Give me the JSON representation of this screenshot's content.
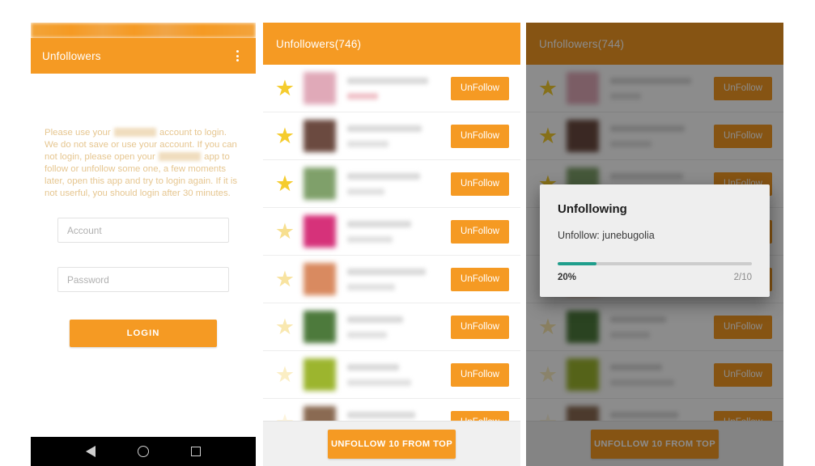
{
  "login_screen": {
    "appbar": {
      "title": "Unfollowers",
      "overflow_label": "⋮"
    },
    "note": {
      "part1": "Please use your",
      "redacted1": "Instagram",
      "part2": "account to login. We do not save or use your account. If you can not login, please open your",
      "redacted2": "Instagram",
      "part3": "app to follow or unfollow some one, a few moments later, open this app and try to login again. If it is not userful, you should login after 30 minutes."
    },
    "account_placeholder": "Account",
    "account_value": "",
    "password_placeholder": "Password",
    "password_value": "",
    "login_button": "LOGIN",
    "navbar": {
      "back": "back-triangle",
      "home": "home-circle",
      "recents": "recents-square"
    }
  },
  "list_screen": {
    "appbar_title": "Unfollowers(746)",
    "unfollow_label": "UnFollow",
    "bulk_button": "UNFOLLOW 10 FROM TOP",
    "star_glyph": "★",
    "rows": [
      {
        "star_color": "#f5cc2e",
        "avatar_color": "#e0a9b8",
        "name_w": "78%",
        "sub_w": "30%",
        "sub_color": "#f0c2c8"
      },
      {
        "star_color": "#f5cc2e",
        "avatar_color": "#6b4a40",
        "name_w": "72%",
        "sub_w": "40%",
        "sub_color": "#e0e0e0"
      },
      {
        "star_color": "#f5cc2e",
        "avatar_color": "#7fa06a",
        "name_w": "70%",
        "sub_w": "36%",
        "sub_color": "#e0e0e0"
      },
      {
        "star_color": "#f7df8f",
        "avatar_color": "#d6327a",
        "name_w": "62%",
        "sub_w": "44%",
        "sub_color": "#e0e0e0"
      },
      {
        "star_color": "#f8e3a0",
        "avatar_color": "#d98a60",
        "name_w": "76%",
        "sub_w": "46%",
        "sub_color": "#e0e0e0"
      },
      {
        "star_color": "#f9e8b0",
        "avatar_color": "#4d7a3c",
        "name_w": "54%",
        "sub_w": "38%",
        "sub_color": "#e0e0e0"
      },
      {
        "star_color": "#fbeec4",
        "avatar_color": "#9cb52e",
        "name_w": "50%",
        "sub_w": "62%",
        "sub_color": "#e0e0e0"
      },
      {
        "star_color": "#fdf4dc",
        "avatar_color": "#8a6a52",
        "name_w": "66%",
        "sub_w": "34%",
        "sub_color": "#e0e0e0"
      }
    ]
  },
  "dialog_screen": {
    "appbar_title": "Unfollowers(744)",
    "unfollow_label": "UnFollow",
    "bulk_button": "UNFOLLOW 10 FROM TOP",
    "star_glyph": "★",
    "rows": [
      {
        "star_color": "#f5cc2e",
        "avatar_color": "#e0a9b8",
        "name_w": "78%",
        "sub_w": "30%"
      },
      {
        "star_color": "#f5cc2e",
        "avatar_color": "#6b4a40",
        "name_w": "72%",
        "sub_w": "40%"
      },
      {
        "star_color": "#f5cc2e",
        "avatar_color": "#7fa06a",
        "name_w": "70%",
        "sub_w": "36%"
      },
      {
        "star_color": "#f7df8f",
        "avatar_color": "#d6327a",
        "name_w": "62%",
        "sub_w": "44%"
      },
      {
        "star_color": "#f8e3a0",
        "avatar_color": "#d98a60",
        "name_w": "76%",
        "sub_w": "46%"
      },
      {
        "star_color": "#f9e8b0",
        "avatar_color": "#4d7a3c",
        "name_w": "54%",
        "sub_w": "38%"
      },
      {
        "star_color": "#fbeec4",
        "avatar_color": "#9cb52e",
        "name_w": "50%",
        "sub_w": "62%"
      },
      {
        "star_color": "#fdf4dc",
        "avatar_color": "#8a6a52",
        "name_w": "66%",
        "sub_w": "34%"
      }
    ],
    "dialog": {
      "title": "Unfollowing",
      "message": "Unfollow: junebugolia",
      "progress_percent_label": "20%",
      "progress_count_label": "2/10",
      "progress_value": 20,
      "progress_fill_color": "#1f9e8c",
      "progress_track_color": "#cccccc"
    }
  },
  "theme": {
    "accent_orange": "#f59a23",
    "dimmed_orange": "#6b4a17",
    "teal": "#1f9e8c",
    "star_gold": "#f5cc2e",
    "navbar_black": "#000000"
  }
}
